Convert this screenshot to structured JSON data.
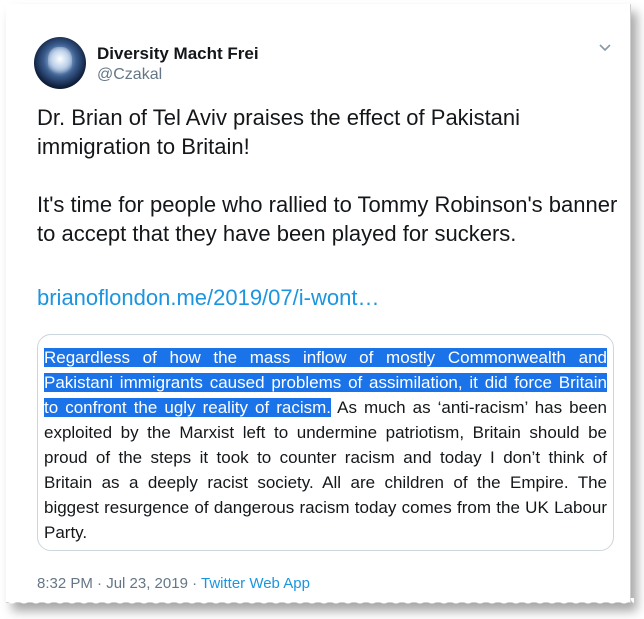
{
  "author": {
    "display_name": "Diversity Macht Frei",
    "handle": "@Czakal"
  },
  "tweet": {
    "paragraph1": "Dr. Brian of Tel Aviv praises the effect of Pakistani immigration to Britain!",
    "paragraph2": "It's time for people who rallied to Tommy Robinson's banner to accept that they have been played for suckers.",
    "link": "brianoflondon.me/2019/07/i-wont…"
  },
  "quote": {
    "highlighted": "Regardless of how the mass inflow of mostly Commonwealth and Pakistani immigrants caused problems of assimilation, it did force Britain to confront the ugly reality of racism.",
    "rest": " As much as ‘anti-racism’ has been exploited by the Marxist left to undermine patriotism, Britain should be proud of the steps it took to counter racism and today I don’t think of Britain as a deeply racist society. All are children of the Empire. The biggest resurgence of dangerous racism today comes from the UK Labour Party."
  },
  "meta": {
    "timestamp": "8:32 PM · Jul 23, 2019 · ",
    "source": "Twitter Web App"
  },
  "colors": {
    "link": "#1b95e0",
    "highlight": "#1a73e8",
    "secondary_text": "#657786"
  },
  "icons": {
    "caret": "chevron-down-icon",
    "avatar": "avatar"
  }
}
